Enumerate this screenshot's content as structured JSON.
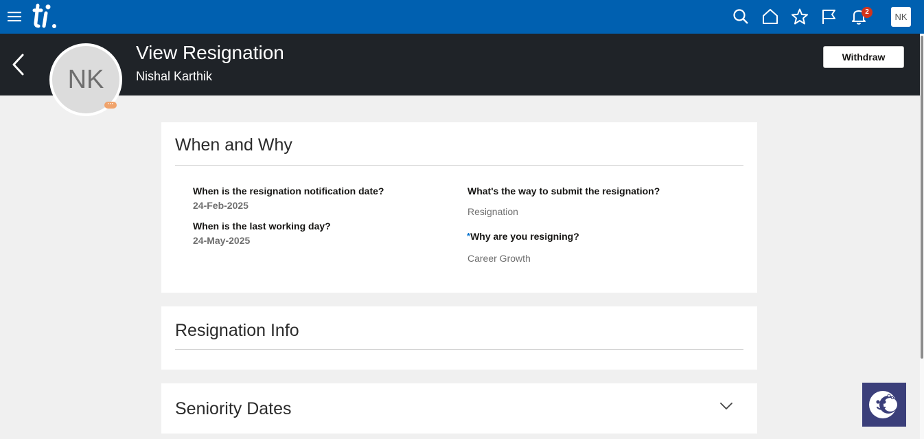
{
  "topbar": {
    "notification_count": "2",
    "user_initials": "NK",
    "icons": [
      "hamburger-menu-icon",
      "search-icon",
      "home-icon",
      "star-icon",
      "flag-icon",
      "bell-icon"
    ],
    "brand_color": "#0060b0"
  },
  "header": {
    "title": "View Resignation",
    "subtitle": "Nishal Karthik",
    "avatar_initials": "NK",
    "withdraw_label": "Withdraw"
  },
  "when_why": {
    "title": "When and Why",
    "fields": [
      {
        "label": "When is the resignation notification date?",
        "value": "24-Feb-2025"
      },
      {
        "label": "When is the last working day?",
        "value": "24-May-2025"
      },
      {
        "label": "What's the way to submit the resignation?",
        "value": "Resignation"
      },
      {
        "label": "Why are you resigning?",
        "value": "Career Growth",
        "required_marker": "*"
      }
    ]
  },
  "resignation_info": {
    "title": "Resignation Info"
  },
  "seniority_dates": {
    "title": "Seniority Dates"
  }
}
